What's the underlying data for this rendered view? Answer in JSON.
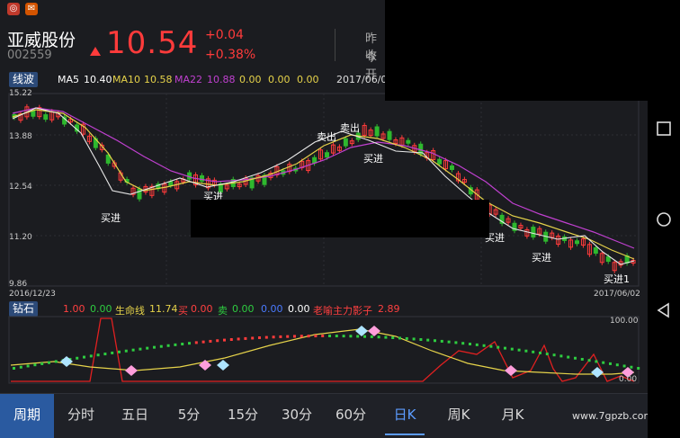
{
  "header": {
    "stock_name": "亚威股份",
    "stock_code": "002559",
    "price": "10.54",
    "change": "+0.04",
    "change_pct": "+0.38%",
    "label_prev": "昨收",
    "label_open": "今开"
  },
  "ma_row": {
    "tag": "线波",
    "ma5_label": "MA5",
    "ma5_value": "10.40",
    "ma10_label": "MA10",
    "ma10_value": "10.58",
    "ma22_label": "MA22",
    "ma22_value": "10.88",
    "extra1": "0.00",
    "extra2": "0.00",
    "extra3": "0.00",
    "date": "2017/06/0"
  },
  "main_chart": {
    "y_ticks": [
      "15.22",
      "13.88",
      "12.54",
      "11.20",
      "9.86"
    ],
    "start_date": "2016/12/23",
    "end_date": "2017/06/02",
    "annotations": [
      "买进",
      "买进",
      "卖出",
      "卖出",
      "买进",
      "买进",
      "买进",
      "买进1"
    ]
  },
  "indicator_row": {
    "tag": "钻石",
    "v1": "1.00",
    "v2": "0.00",
    "life_label": "生命线",
    "life_value": "11.74",
    "buy_label": "买",
    "buy_value": "0.00",
    "sell_label": "卖",
    "sell_value": "0.00",
    "v3": "0.00",
    "v4": "0.00",
    "shadow_label": "老喻主力影子",
    "shadow_value": "2.89"
  },
  "indicator_chart": {
    "y_top": "100.00",
    "y_bottom": "0.00"
  },
  "tabs": {
    "period": "周期",
    "t1": "分时",
    "t2": "五日",
    "t3": "5分",
    "t4": "15分",
    "t5": "30分",
    "t6": "60分",
    "t7": "日K",
    "t8": "周K",
    "t9": "月K"
  },
  "watermark": "www.7gpzb.com",
  "colors": {
    "up": "#ff3b3b",
    "down": "#2eb82e",
    "ma5": "#ffffff",
    "ma10": "#e6d34a",
    "ma22": "#c040d0"
  }
}
